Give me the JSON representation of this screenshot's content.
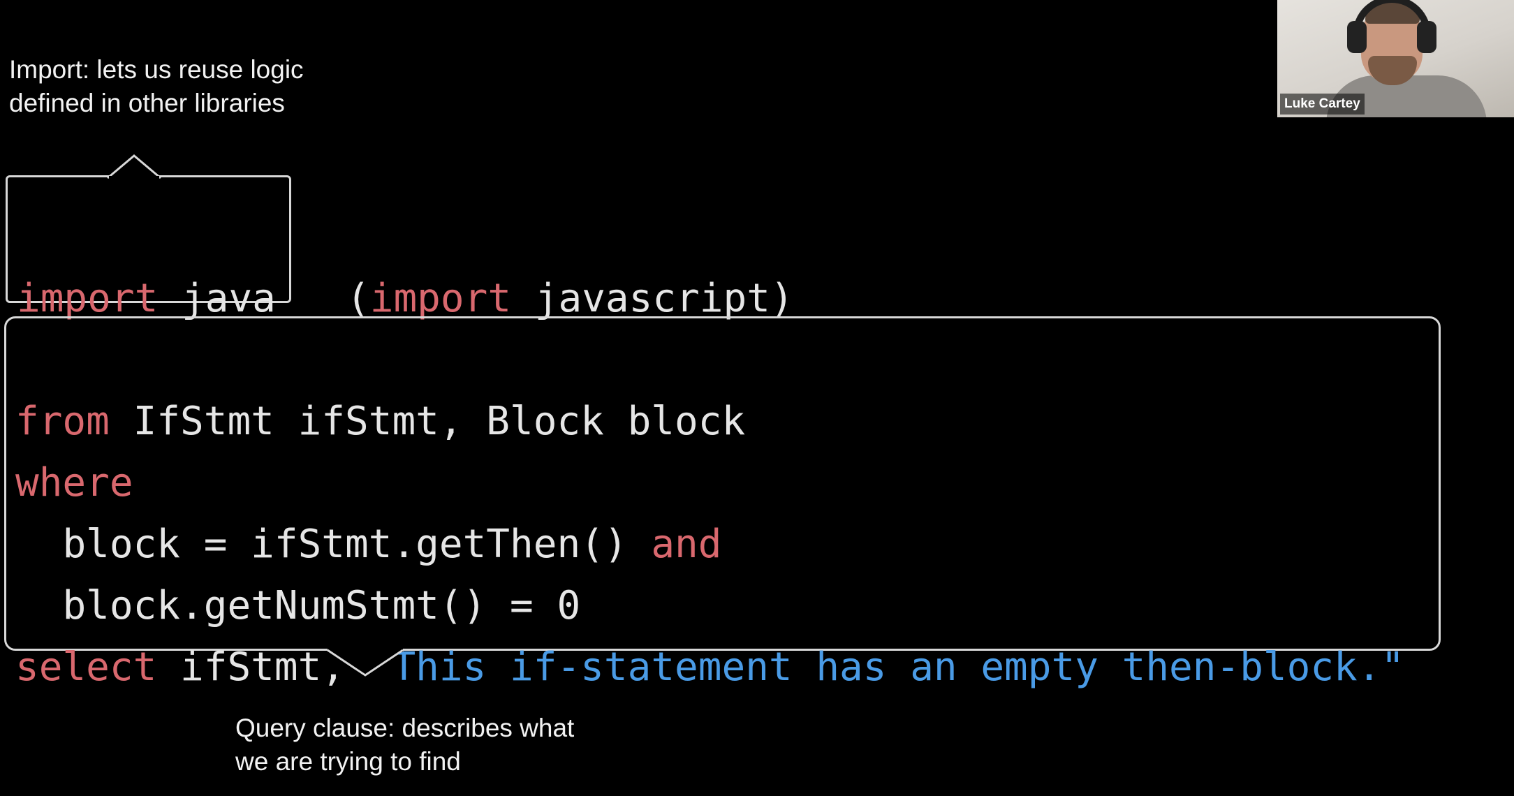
{
  "annotations": {
    "import_note": "Import: lets us reuse logic\ndefined in other libraries",
    "query_note": "Query clause: describes what\nwe are trying to find"
  },
  "import_line": {
    "kw1": "import",
    "mod1": "java",
    "open": "(",
    "kw2": "import",
    "mod2": "javascript",
    "close": ")"
  },
  "query": {
    "line1": {
      "kw": "from",
      "rest": "IfStmt ifStmt, Block block"
    },
    "line2": {
      "kw": "where"
    },
    "line3": {
      "text": "block = ifStmt.getThen()",
      "kw": "and"
    },
    "line4": {
      "text": "block.getNumStmt() = 0"
    },
    "line5": {
      "kw": "select",
      "rest": "ifStmt,",
      "str": "\"This if-statement has an empty then-block.\""
    }
  },
  "video": {
    "participant_name": "Luke Cartey"
  },
  "colors": {
    "keyword": "#d9686e",
    "string": "#4a9be6",
    "code_text": "#e6e6e6",
    "background": "#000000",
    "border": "#d8d8d8"
  }
}
